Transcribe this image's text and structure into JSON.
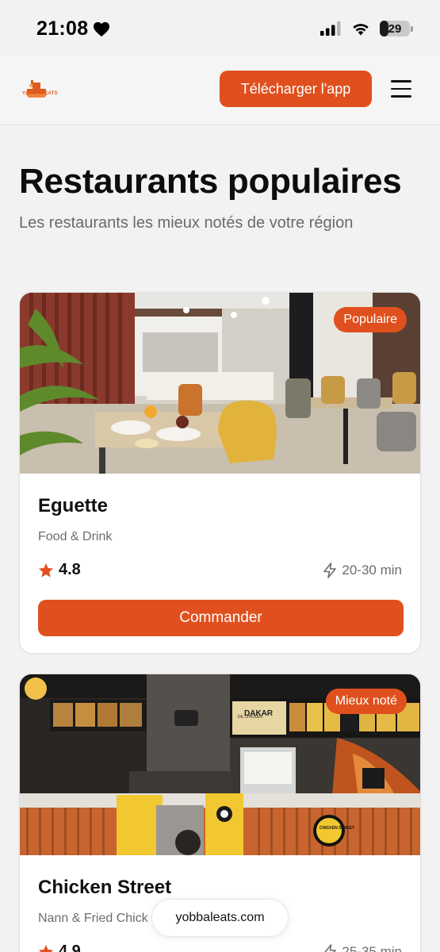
{
  "status_bar": {
    "time": "21:08",
    "battery": "29",
    "icons": [
      "heart-icon",
      "signal-icon",
      "wifi-icon",
      "battery-icon"
    ]
  },
  "header": {
    "logo_text": "YOBBAL EATS",
    "download_label": "Télécharger l'app",
    "menu_icon": "hamburger-menu-icon"
  },
  "page": {
    "title": "Restaurants populaires",
    "subtitle": "Les restaurants les mieux notés de votre région"
  },
  "restaurants": [
    {
      "badge": "Populaire",
      "name": "Eguette",
      "category": "Food & Drink",
      "rating": "4.8",
      "delivery_time": "20-30 min",
      "order_label": "Commander"
    },
    {
      "badge": "Mieux noté",
      "name": "Chicken Street",
      "category": "Nann & Fried Chick",
      "rating": "4.9",
      "delivery_time": "25-35 min"
    }
  ],
  "image_texts": {
    "sign": "DAKAR",
    "sign_small": "DE CHICKEN",
    "counter_logo": "CHICKEN STREET"
  },
  "url_bar": {
    "url": "yobbaleats.com"
  },
  "colors": {
    "accent": "#e0501e",
    "background": "#f2f2f2",
    "card": "#ffffff",
    "muted_text": "#6d6d6d"
  }
}
